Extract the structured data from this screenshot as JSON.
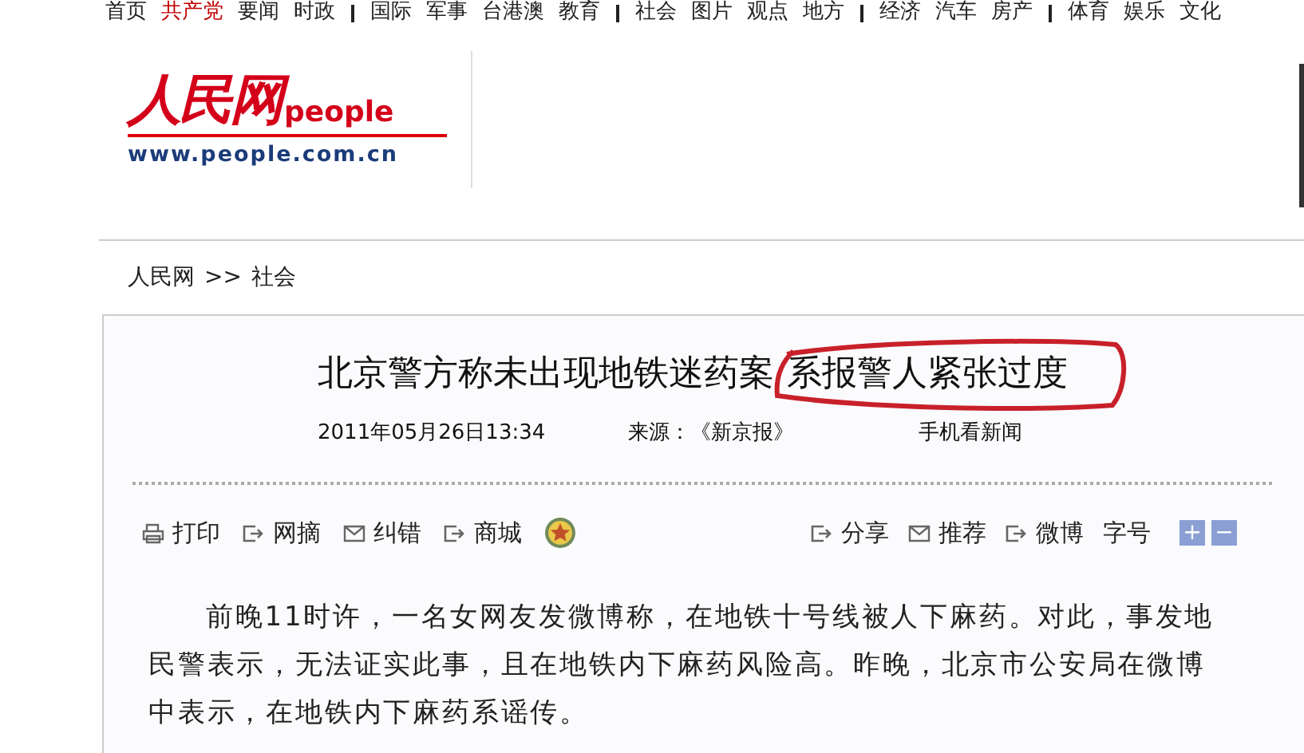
{
  "nav": {
    "groups": [
      [
        {
          "label": "首页",
          "highlighted": false
        },
        {
          "label": "共产党",
          "highlighted": true
        },
        {
          "label": "要闻",
          "highlighted": false
        },
        {
          "label": "时政",
          "highlighted": false
        }
      ],
      [
        {
          "label": "国际",
          "highlighted": false
        },
        {
          "label": "军事",
          "highlighted": false
        },
        {
          "label": "台港澳",
          "highlighted": false
        },
        {
          "label": "教育",
          "highlighted": false
        }
      ],
      [
        {
          "label": "社会",
          "highlighted": false
        },
        {
          "label": "图片",
          "highlighted": false
        },
        {
          "label": "观点",
          "highlighted": false
        },
        {
          "label": "地方",
          "highlighted": false
        }
      ],
      [
        {
          "label": "经济",
          "highlighted": false
        },
        {
          "label": "汽车",
          "highlighted": false
        },
        {
          "label": "房产",
          "highlighted": false
        }
      ],
      [
        {
          "label": "体育",
          "highlighted": false
        },
        {
          "label": "娱乐",
          "highlighted": false
        },
        {
          "label": "文化",
          "highlighted": false
        }
      ]
    ]
  },
  "logo": {
    "name": "人民网",
    "latin": "people",
    "url": "www.people.com.cn"
  },
  "breadcrumb": [
    "人民网",
    ">>",
    "社会"
  ],
  "article": {
    "title_parts": [
      {
        "text": "北京警方称未出现地铁迷药案",
        "circled": false
      },
      {
        "text": "系报警人紧张过度",
        "circled": true
      }
    ],
    "date": "2011年05月26日13:34",
    "source": "来源：《新京报》",
    "mobile": "手机看新闻",
    "tools_left": [
      {
        "label": "打印",
        "kind": "print"
      },
      {
        "label": "网摘",
        "kind": "export"
      },
      {
        "label": "纠错",
        "kind": "mail"
      },
      {
        "label": "商城",
        "kind": "export"
      }
    ],
    "tools_right": [
      {
        "label": "分享",
        "kind": "export"
      },
      {
        "label": "推荐",
        "kind": "mail"
      },
      {
        "label": "微博",
        "kind": "export"
      }
    ],
    "font_size": {
      "label": "字号",
      "increase": "+",
      "decrease": "−"
    },
    "body": "前晚11时许，一名女网友发微博称，在地铁十号线被人下麻药。对此，事发地民警表示，无法证实此事，且在地铁内下麻药风险高。昨晚，北京市公安局在微博中表示，在地铁内下麻药系谣传。"
  }
}
